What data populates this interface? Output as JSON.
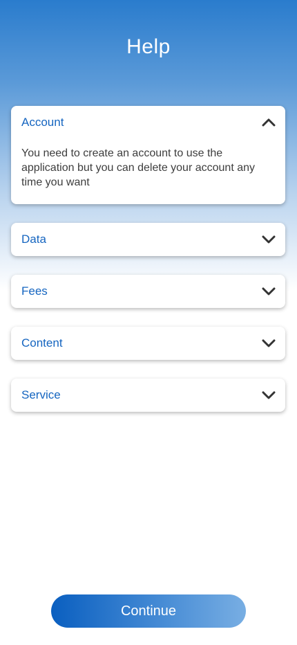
{
  "header": {
    "title": "Help"
  },
  "faq": [
    {
      "label": "Account",
      "expanded": true,
      "body": "You need to create an account to use the application but you can delete your account any time you want",
      "icon": "chevron-up-icon"
    },
    {
      "label": "Data",
      "expanded": false,
      "icon": "chevron-down-icon"
    },
    {
      "label": "Fees",
      "expanded": false,
      "icon": "chevron-down-icon"
    },
    {
      "label": "Content",
      "expanded": false,
      "icon": "chevron-down-icon"
    },
    {
      "label": "Service",
      "expanded": false,
      "icon": "chevron-down-icon"
    }
  ],
  "footer": {
    "continue_label": "Continue"
  },
  "colors": {
    "accent": "#1565c0",
    "header_gradient_top": "#2a7ccd",
    "body_text": "#3d3d3d",
    "chevron": "#333333"
  }
}
